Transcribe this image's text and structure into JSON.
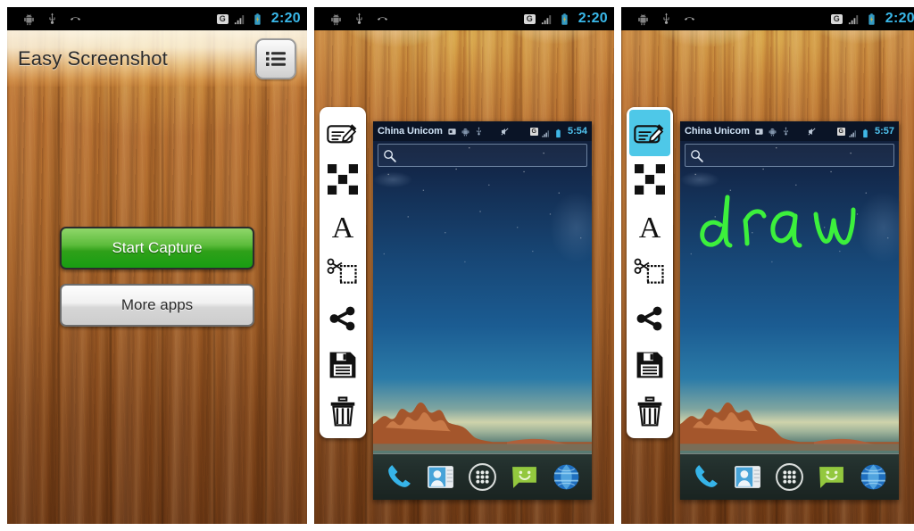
{
  "panels": [
    {
      "id": "app-home",
      "status_bar": {
        "icons": [
          "android-icon",
          "usb-icon",
          "missed-call-icon"
        ],
        "network_badge": "G",
        "signal_icon": "signal-bars-icon",
        "battery_icon": "battery-charging-icon",
        "clock": "2:20"
      },
      "action_bar": {
        "title": "Easy Screenshot",
        "menu_icon": "list-menu-icon"
      },
      "buttons": [
        {
          "label": "Start Capture",
          "style": "primary"
        },
        {
          "label": "More apps",
          "style": "secondary"
        }
      ]
    },
    {
      "id": "editor-blank",
      "status_bar": {
        "icons": [
          "android-icon",
          "usb-icon",
          "missed-call-icon"
        ],
        "network_badge": "G",
        "signal_icon": "signal-bars-icon",
        "battery_icon": "battery-charging-icon",
        "clock": "2:20"
      },
      "toolbar": {
        "tools": [
          {
            "name": "draw-tool",
            "icon": "pen-edit-icon",
            "active": false
          },
          {
            "name": "mosaic-tool",
            "icon": "checkerboard-icon",
            "active": false
          },
          {
            "name": "text-tool",
            "icon": "letter-a-icon",
            "active": false
          },
          {
            "name": "crop-tool",
            "icon": "scissors-crop-icon",
            "active": false
          },
          {
            "name": "share-tool",
            "icon": "share-icon",
            "active": false
          },
          {
            "name": "save-tool",
            "icon": "floppy-save-icon",
            "active": false
          },
          {
            "name": "delete-tool",
            "icon": "trash-icon",
            "active": false
          }
        ]
      },
      "phone": {
        "carrier": "China Unicom",
        "status_icons": [
          "sd-card-icon",
          "android-icon",
          "usb-icon",
          "mute-icon"
        ],
        "network_badge": "G",
        "clock": "5:54",
        "search_placeholder": "",
        "search_icon": "search-icon",
        "annotation": "",
        "dock": [
          {
            "name": "phone-icon"
          },
          {
            "name": "contacts-icon"
          },
          {
            "name": "app-drawer-icon"
          },
          {
            "name": "messaging-icon"
          },
          {
            "name": "browser-icon"
          }
        ]
      }
    },
    {
      "id": "editor-drawn",
      "status_bar": {
        "icons": [
          "android-icon",
          "usb-icon",
          "missed-call-icon"
        ],
        "network_badge": "G",
        "signal_icon": "signal-bars-icon",
        "battery_icon": "battery-charging-icon",
        "clock": "2:20"
      },
      "toolbar": {
        "tools": [
          {
            "name": "draw-tool",
            "icon": "pen-edit-icon",
            "active": true
          },
          {
            "name": "mosaic-tool",
            "icon": "checkerboard-icon",
            "active": false
          },
          {
            "name": "text-tool",
            "icon": "letter-a-icon",
            "active": false
          },
          {
            "name": "crop-tool",
            "icon": "scissors-crop-icon",
            "active": false
          },
          {
            "name": "share-tool",
            "icon": "share-icon",
            "active": false
          },
          {
            "name": "save-tool",
            "icon": "floppy-save-icon",
            "active": false
          },
          {
            "name": "delete-tool",
            "icon": "trash-icon",
            "active": false
          }
        ]
      },
      "phone": {
        "carrier": "China Unicom",
        "status_icons": [
          "sd-card-icon",
          "android-icon",
          "usb-icon",
          "mute-icon"
        ],
        "network_badge": "G",
        "clock": "5:57",
        "search_placeholder": "",
        "search_icon": "search-icon",
        "annotation": "draw",
        "dock": [
          {
            "name": "phone-icon"
          },
          {
            "name": "contacts-icon"
          },
          {
            "name": "app-drawer-icon"
          },
          {
            "name": "messaging-icon"
          },
          {
            "name": "browser-icon"
          }
        ]
      }
    }
  ],
  "colors": {
    "accent_green": "#2fa019",
    "tool_active": "#4ec8e8",
    "annotation_green": "#3cf03c",
    "clock_blue": "#39b7e8",
    "wood_base": "#a4612c"
  }
}
